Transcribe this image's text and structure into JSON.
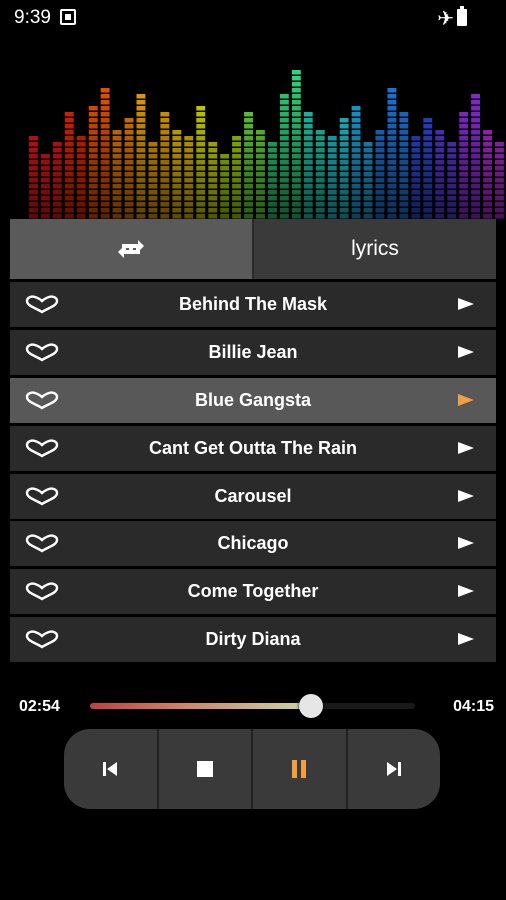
{
  "status_bar": {
    "time": "9:39",
    "icons": [
      "photo-icon",
      "airplane-icon",
      "battery-icon"
    ]
  },
  "visualizer": {
    "colors": [
      "#ff1a1a",
      "#ff2a00",
      "#ff5a00",
      "#ff8a00",
      "#ffb000",
      "#ffd000",
      "#e8f000",
      "#b8f000",
      "#70f040",
      "#30e080",
      "#20e0c0",
      "#20d8e8",
      "#20b0f0",
      "#2080f0",
      "#3050f0",
      "#6040f0",
      "#9a30f0",
      "#c030e8"
    ],
    "levels": [
      0.55,
      0.45,
      0.5,
      0.7,
      0.55,
      0.75,
      0.85,
      0.6,
      0.65,
      0.8,
      0.5,
      0.7,
      0.6,
      0.55,
      0.75,
      0.5,
      0.45,
      0.55,
      0.7,
      0.6,
      0.5,
      0.8,
      0.95,
      0.7,
      0.6,
      0.55,
      0.65,
      0.75,
      0.5,
      0.6,
      0.85,
      0.7,
      0.55,
      0.65,
      0.6,
      0.5,
      0.7,
      0.8,
      0.6,
      0.5
    ]
  },
  "tabs": {
    "repeat_icon": "repeat-icon",
    "lyrics_label": "lyrics"
  },
  "playlist": [
    {
      "title": "Behind The Mask",
      "active": false
    },
    {
      "title": "Billie Jean",
      "active": false
    },
    {
      "title": "Blue Gangsta",
      "active": true
    },
    {
      "title": "Cant Get Outta The Rain",
      "active": false
    },
    {
      "title": "Carousel",
      "active": false
    },
    {
      "title": "Chicago",
      "active": false
    },
    {
      "title": "Come Together",
      "active": false
    },
    {
      "title": "Dirty Diana",
      "active": false
    }
  ],
  "player": {
    "elapsed": "02:54",
    "total": "04:15",
    "progress": 0.68,
    "state": "playing"
  },
  "controls": [
    {
      "name": "previous-button",
      "icon": "skip-previous-icon",
      "color": "#ffffff"
    },
    {
      "name": "stop-button",
      "icon": "stop-icon",
      "color": "#ffffff"
    },
    {
      "name": "pause-button",
      "icon": "pause-icon",
      "color": "#f0a040"
    },
    {
      "name": "next-button",
      "icon": "skip-next-icon",
      "color": "#ffffff"
    }
  ]
}
